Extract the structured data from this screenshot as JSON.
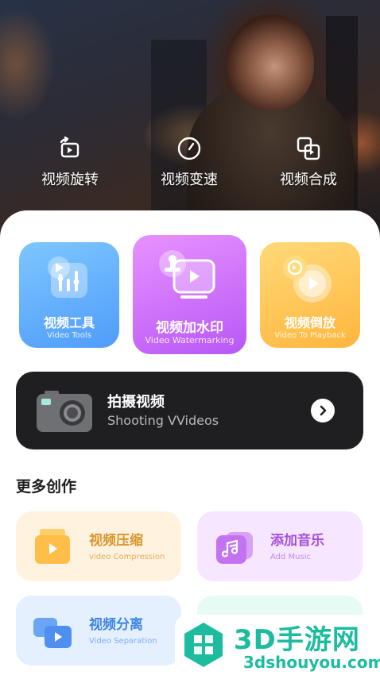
{
  "quick_actions": [
    {
      "label": "视频旋转",
      "icon": "rotate-screen-icon"
    },
    {
      "label": "视频变速",
      "icon": "speedometer-icon"
    },
    {
      "label": "视频合成",
      "icon": "merge-icon"
    }
  ],
  "feature_cards": [
    {
      "title": "视频工具",
      "subtitle": "Video Tools",
      "icon": "equalizer-icon"
    },
    {
      "title": "视频加水印",
      "subtitle": "Video Watermarking",
      "icon": "stamp-icon"
    },
    {
      "title": "视频倒放",
      "subtitle": "Video To Playback",
      "icon": "reverse-play-icon"
    }
  ],
  "shoot": {
    "title": "拍摄视频",
    "subtitle": "Shooting VVideos",
    "icon": "camera-icon"
  },
  "more": {
    "title": "更多创作",
    "items": [
      {
        "title": "视频压缩",
        "subtitle": "video Compression",
        "icon": "compress-box-icon"
      },
      {
        "title": "添加音乐",
        "subtitle": "Add Music",
        "icon": "music-note-icon"
      },
      {
        "title": "视频分离",
        "subtitle": "Video Separation",
        "icon": "split-icon"
      }
    ]
  },
  "watermark": {
    "brand": "3D手游网",
    "url": "3dshouyou.com"
  },
  "colors": {
    "tool_blue": "#5aa8ff",
    "watermark_purple": "#c666f7",
    "playback_orange": "#ffc24d",
    "watermark_brand": "#1dbc9f"
  }
}
